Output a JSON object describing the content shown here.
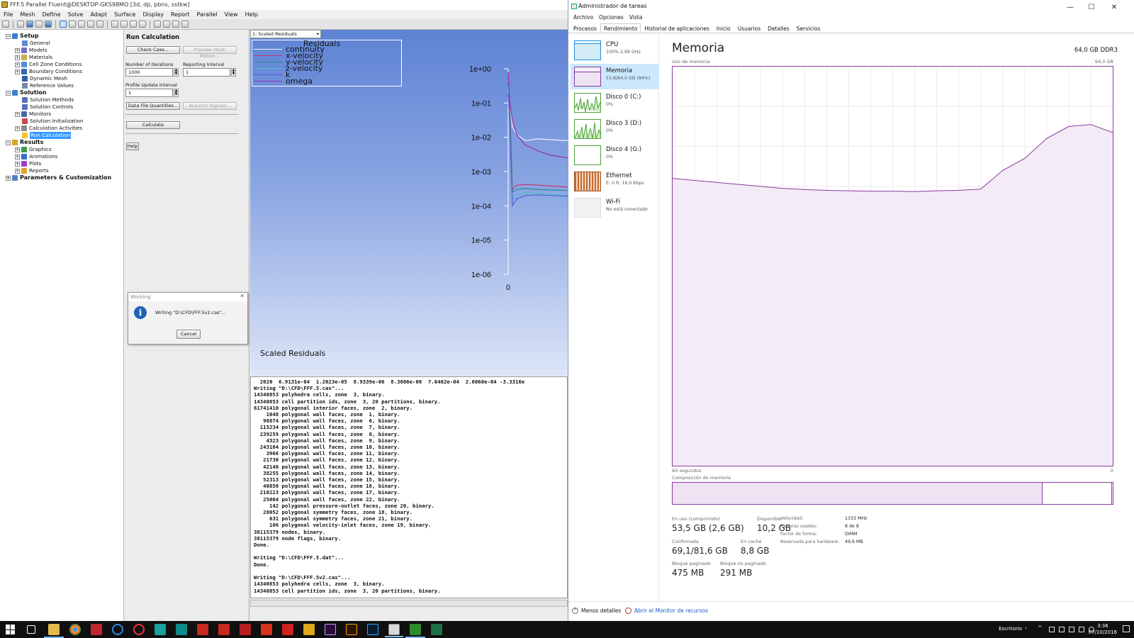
{
  "fluent": {
    "window_title": "FFF.5 Parallel Fluent@DESKTOP-GKS98MO  [3d, dp, pbns, sstkw]",
    "menu": [
      "File",
      "Mesh",
      "Define",
      "Solve",
      "Adapt",
      "Surface",
      "Display",
      "Report",
      "Parallel",
      "View",
      "Help"
    ],
    "tree": {
      "setup": "Setup",
      "setup_items": [
        "General",
        "Models",
        "Materials",
        "Cell Zone Conditions",
        "Boundary Conditions",
        "Dynamic Mesh",
        "Reference Values"
      ],
      "solution": "Solution",
      "solution_items": [
        "Solution Methods",
        "Solution Controls",
        "Monitors",
        "Solution Initialization",
        "Calculation Activities",
        "Run Calculation"
      ],
      "results": "Results",
      "results_items": [
        "Graphics",
        "Animations",
        "Plots",
        "Reports"
      ],
      "params": "Parameters & Customization"
    },
    "task": {
      "title": "Run Calculation",
      "check_case": "Check Case...",
      "preview_mesh": "Preview Mesh Motion...",
      "iterations_label": "Number of Iterations",
      "iterations_value": "1000",
      "reporting_label": "Reporting Interval",
      "reporting_value": "1",
      "profile_label": "Profile Update Interval",
      "profile_value": "1",
      "data_file": "Data File Quantities...",
      "acoustic": "Acoustic Signals...",
      "calculate": "Calculate",
      "help": "Help"
    },
    "graphics": {
      "selector": "1: Scaled Residuals",
      "caption": "Scaled Residuals",
      "legend_title": "Residuals"
    },
    "working": {
      "title": "Working",
      "message": "Writing \"D:\\CFD\\FFF.5v2.cas\"...",
      "cancel": "Cancel"
    },
    "console_lines": [
      "  2020  6.9131e-04  1.2023e-05  8.9339e-06  8.3606e-06  7.6462e-04  2.6060e-04 -3.3316e",
      "Writing \"D:\\CFD\\FFF.5.cas\"...",
      "14340853 polyhedra cells, zone  3, binary.",
      "14340853 cell partition ids, zone  3, 20 partitions, binary.",
      "61741410 polygonal interior faces, zone  2, binary.",
      "    1048 polygonal wall faces, zone  1, binary.",
      "   96874 polygonal wall faces, zone  6, binary.",
      "  115234 polygonal wall faces, zone  7, binary.",
      "  239259 polygonal wall faces, zone  8, binary.",
      "    4323 polygonal wall faces, zone  9, binary.",
      "  243104 polygonal wall faces, zone 10, binary.",
      "    3966 polygonal wall faces, zone 11, binary.",
      "   21730 polygonal wall faces, zone 12, binary.",
      "   42140 polygonal wall faces, zone 13, binary.",
      "   38255 polygonal wall faces, zone 14, binary.",
      "   52313 polygonal wall faces, zone 15, binary.",
      "   40850 polygonal wall faces, zone 16, binary.",
      "  210223 polygonal wall faces, zone 17, binary.",
      "   25004 polygonal wall faces, zone 22, binary.",
      "     142 polygonal pressure-outlet faces, zone 20, binary.",
      "   28052 polygonal symmetry faces, zone 18, binary.",
      "     631 polygonal symmetry faces, zone 21, binary.",
      "     106 polygonal velocity-inlet faces, zone 19, binary.",
      "38115379 nodes, binary.",
      "38115379 node flags, binary.",
      "Done.",
      "",
      "Writing \"D:\\CFD\\FFF.5.dat\"...",
      "Done.",
      "",
      "Writing \"D:\\CFD\\FFF.5v2.cas\"...",
      "14340853 polyhedra cells, zone  3, binary.",
      "14340853 cell partition ids, zone  3, 20 partitions, binary."
    ]
  },
  "chart_data": {
    "type": "line",
    "title": "Scaled Residuals",
    "legend_title": "Residuals",
    "yscale": "log",
    "ylim": [
      1e-06,
      1
    ],
    "y_ticks": [
      "1e+00",
      "1e-01",
      "1e-02",
      "1e-03",
      "1e-04",
      "1e-05",
      "1e-06"
    ],
    "x_ticks": [
      "0"
    ],
    "series": [
      {
        "name": "continuity",
        "color": "#f0f4ff",
        "x": [
          0,
          2,
          5,
          10,
          20,
          35,
          50,
          70
        ],
        "y": [
          0.5,
          0.1,
          0.02,
          0.012,
          0.008,
          0.009,
          0.0085,
          0.008
        ]
      },
      {
        "name": "x-velocity",
        "color": "#cc3366",
        "x": [
          0,
          2,
          5,
          10,
          20,
          35,
          50,
          70
        ],
        "y": [
          0.6,
          0.05,
          0.0003,
          0.0004,
          0.00042,
          0.0004,
          0.00038,
          0.00035
        ]
      },
      {
        "name": "y-velocity",
        "color": "#2d8a8a",
        "x": [
          0,
          2,
          5,
          10,
          20,
          35,
          50,
          70
        ],
        "y": [
          0.4,
          0.04,
          0.00025,
          0.0003,
          0.00032,
          0.0003,
          0.00029,
          0.00028
        ]
      },
      {
        "name": "z-velocity",
        "color": "#46c3c3",
        "x": [
          0,
          2,
          5,
          10,
          20,
          35,
          50,
          70
        ],
        "y": [
          0.3,
          0.01,
          0.00015,
          0.0002,
          0.00024,
          0.00023,
          0.00022,
          0.0002
        ]
      },
      {
        "name": "k",
        "color": "#5a5ad6",
        "x": [
          0,
          2,
          5,
          10,
          20,
          35,
          50,
          70
        ],
        "y": [
          0.2,
          0.02,
          0.0001,
          0.00016,
          0.0002,
          0.00021,
          0.0002,
          0.00019
        ]
      },
      {
        "name": "omega",
        "color": "#9b2fae",
        "x": [
          0,
          2,
          5,
          10,
          20,
          35,
          50,
          70
        ],
        "y": [
          0.8,
          0.1,
          0.03,
          0.012,
          0.006,
          0.004,
          0.003,
          0.0025
        ]
      }
    ]
  },
  "taskmgr": {
    "window_title": "Administrador de tareas",
    "menu": [
      "Archivo",
      "Opciones",
      "Vista"
    ],
    "tabs": [
      "Procesos",
      "Rendimiento",
      "Historial de aplicaciones",
      "Inicio",
      "Usuarios",
      "Detalles",
      "Servicios"
    ],
    "active_tab": "Rendimiento",
    "resources": [
      {
        "name": "CPU",
        "sub": "100%  2,99 GHz",
        "color": "#1e8fd6"
      },
      {
        "name": "Memoria",
        "sub": "53,8/64,0 GB (84%)",
        "color": "#8b3a9f"
      },
      {
        "name": "Disco 0 (C:)",
        "sub": "0%",
        "color": "#4da23a"
      },
      {
        "name": "Disco 3 (D:)",
        "sub": "0%",
        "color": "#4da23a"
      },
      {
        "name": "Disco 4 (G:)",
        "sub": "0%",
        "color": "#4da23a"
      },
      {
        "name": "Ethernet",
        "sub": "E: 0 R: 16,0 Kbps",
        "color": "#a0521e"
      },
      {
        "name": "Wi-Fi",
        "sub": "No está conectado",
        "color": "#a0521e"
      }
    ],
    "memory": {
      "heading": "Memoria",
      "total": "64,0 GB DDR3",
      "usage_label": "Uso de memoria",
      "max_label": "64,0 GB",
      "time_left": "60 segundos",
      "time_right": "0",
      "composition_label": "Composición de memoria",
      "in_use_label": "En uso (comprimido)",
      "in_use_value": "53,5 GB (2,6 GB)",
      "available_label": "Disponible",
      "available_value": "10,2 GB",
      "committed_label": "Confirmada",
      "committed_value": "69,1/81,6 GB",
      "cached_label": "En caché",
      "cached_value": "8,8 GB",
      "paged_label": "Bloque paginado",
      "paged_value": "475 MB",
      "nonpaged_label": "Bloque no paginado",
      "nonpaged_value": "291 MB",
      "speed_label": "Velocidad:",
      "speed_value": "1333 MHz",
      "slots_label": "Ranuras usadas:",
      "slots_value": "8 de 8",
      "form_label": "Factor de forma:",
      "form_value": "DIMM",
      "reserved_label": "Reservada para hardware:",
      "reserved_value": "49,6 MB",
      "usage_history_pct": [
        72,
        71.5,
        71,
        70.5,
        70,
        69.5,
        69.2,
        69,
        68.9,
        68.8,
        68.8,
        68.7,
        68.9,
        69,
        69.3,
        74,
        77,
        82,
        85,
        85.5,
        83.5
      ],
      "composition_in_use_fraction": 0.84
    },
    "footer_less": "Menos detalles",
    "footer_monitor": "Abrir el Monitor de recursos"
  },
  "taskbar": {
    "escritorio": "Escritorio",
    "time": "3:36",
    "date": "07/10/2016"
  }
}
